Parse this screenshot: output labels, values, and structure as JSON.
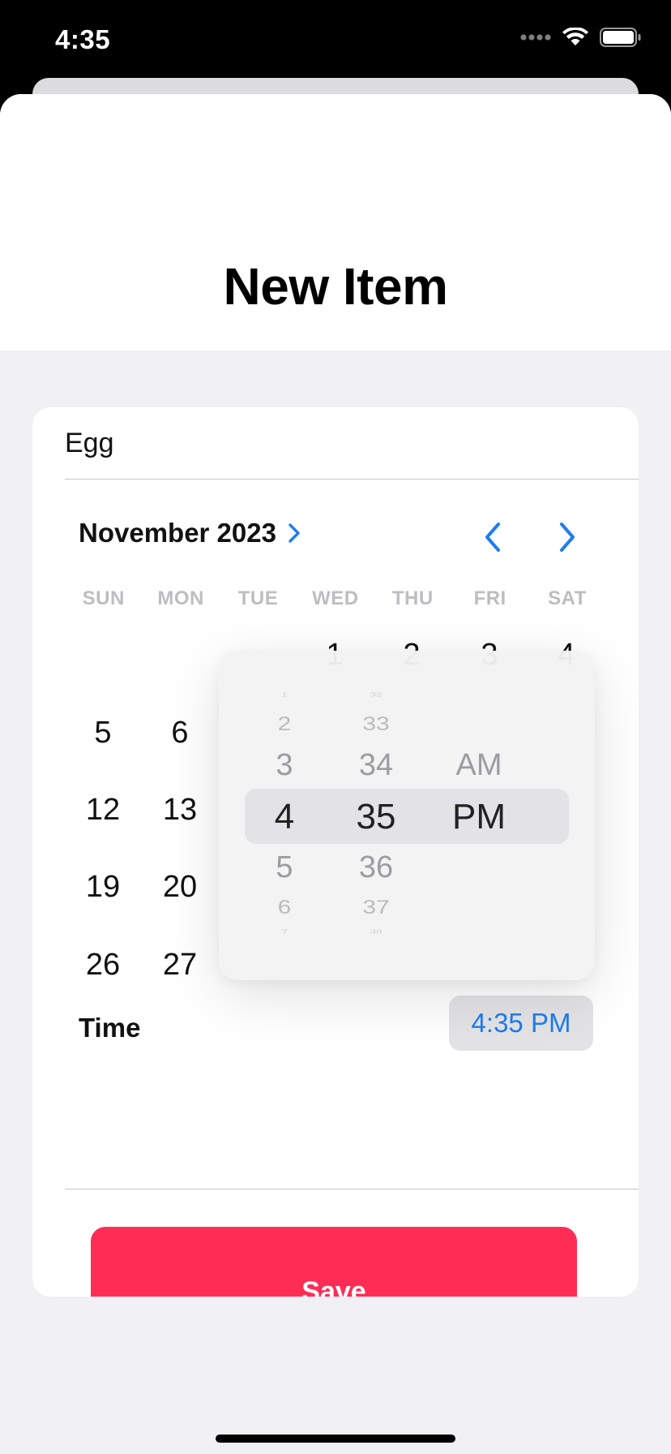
{
  "status_bar": {
    "time": "4:35",
    "icons": [
      "cellular-icon",
      "wifi-icon",
      "battery-icon"
    ]
  },
  "header": {
    "title": "New Item"
  },
  "form": {
    "name_value": "Egg",
    "calendar": {
      "month_label": "November 2023",
      "weekdays": [
        "SUN",
        "MON",
        "TUE",
        "WED",
        "THU",
        "FRI",
        "SAT"
      ],
      "visible_days": {
        "row1": [
          "1",
          "2",
          "3",
          "4"
        ],
        "row2": [
          "5",
          "6"
        ],
        "row3": [
          "12",
          "13"
        ],
        "row4": [
          "19",
          "20"
        ],
        "row5": [
          "26",
          "27"
        ]
      }
    },
    "time": {
      "label": "Time",
      "value": "4:35 PM"
    },
    "time_picker": {
      "hours": [
        "1",
        "2",
        "3",
        "4",
        "5",
        "6",
        "7"
      ],
      "minutes": [
        "32",
        "33",
        "34",
        "35",
        "36",
        "37",
        "38"
      ],
      "periods": [
        "AM",
        "PM"
      ],
      "selected_hour": "4",
      "selected_minute": "35",
      "selected_period": "PM"
    },
    "save_label": "Save"
  },
  "colors": {
    "accent": "#1f7cf0",
    "save_button": "#ff2d55",
    "background": "#f0f0f5"
  }
}
